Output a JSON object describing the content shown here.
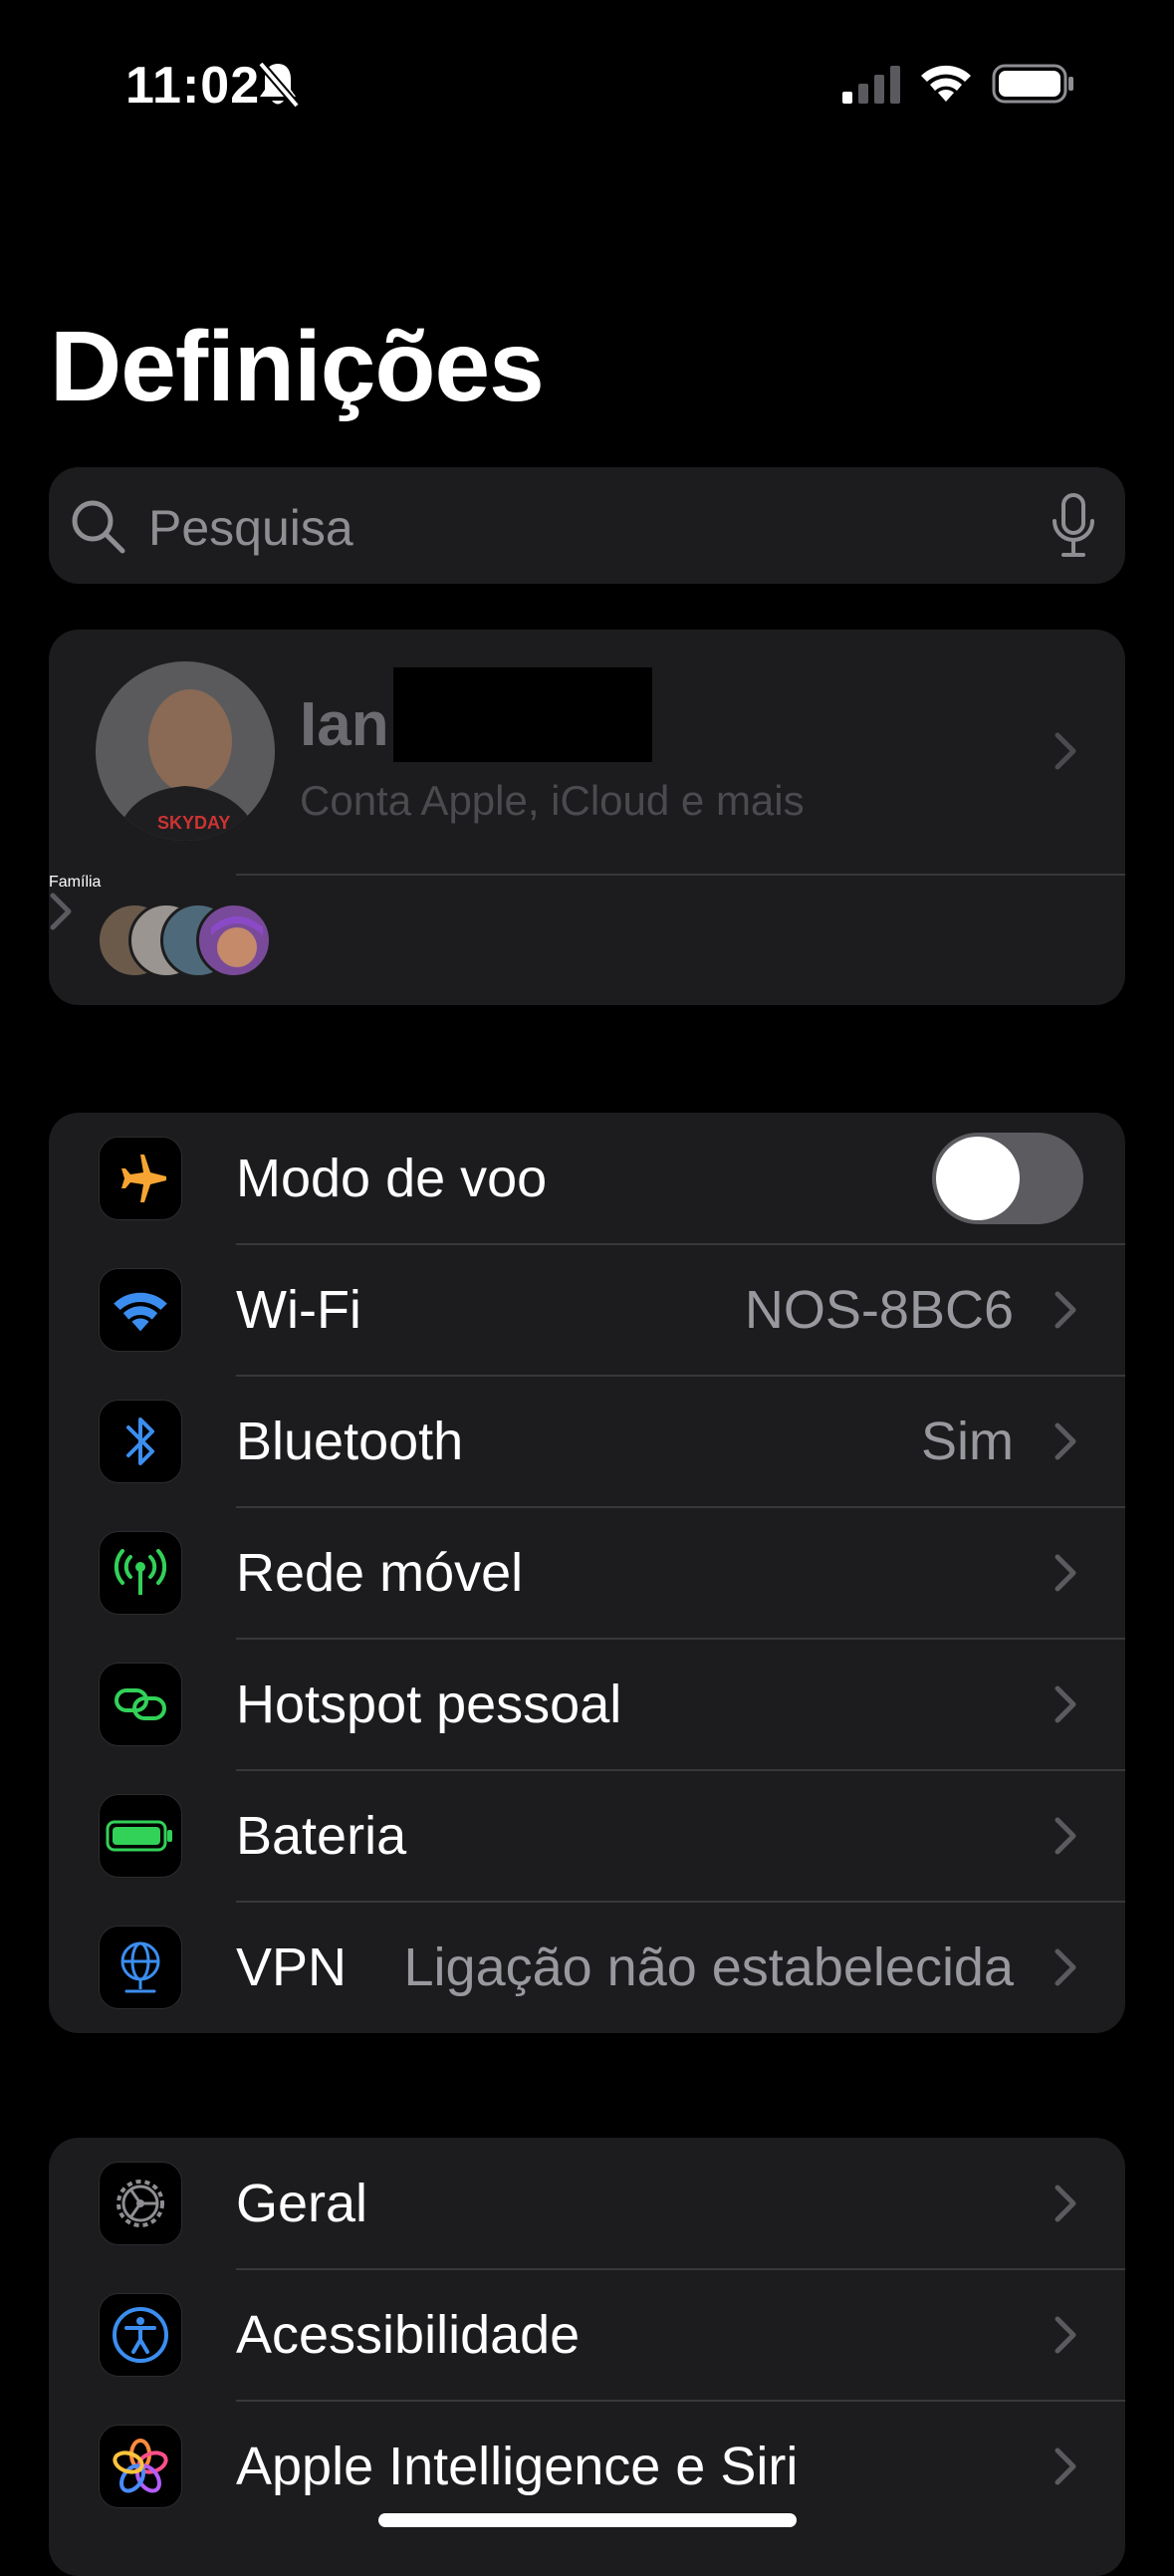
{
  "status_bar": {
    "time": "11:02",
    "silent_mode": true,
    "signal_bars": 1
  },
  "title": "Definições",
  "search": {
    "placeholder": "Pesquisa"
  },
  "profile": {
    "name": "Ian",
    "subtitle": "Conta Apple, iCloud e mais",
    "family_label": "Família"
  },
  "connectivity": [
    {
      "id": "airplane",
      "label": "Modo de voo",
      "value": "",
      "toggle": true,
      "toggle_on": false,
      "icon": "airplane-icon",
      "icon_color": "#f7a532"
    },
    {
      "id": "wifi",
      "label": "Wi-Fi",
      "value": "NOS-8BC6",
      "icon": "wifi-icon",
      "icon_color": "#3b8ef0"
    },
    {
      "id": "bluetooth",
      "label": "Bluetooth",
      "value": "Sim",
      "icon": "bluetooth-icon",
      "icon_color": "#3b8ef0"
    },
    {
      "id": "cellular",
      "label": "Rede móvel",
      "value": "",
      "icon": "antenna-icon",
      "icon_color": "#32d158"
    },
    {
      "id": "hotspot",
      "label": "Hotspot pessoal",
      "value": "",
      "icon": "hotspot-link-icon",
      "icon_color": "#32d158"
    },
    {
      "id": "battery",
      "label": "Bateria",
      "value": "",
      "icon": "battery-icon",
      "icon_color": "#32d158"
    },
    {
      "id": "vpn",
      "label": "VPN",
      "value": "Ligação não estabelecida",
      "icon": "globe-icon",
      "icon_color": "#3b8ef0"
    }
  ],
  "general": [
    {
      "id": "general",
      "label": "Geral",
      "icon": "gear-icon",
      "icon_color": "#8e8e93"
    },
    {
      "id": "accessibility",
      "label": "Acessibilidade",
      "icon": "accessibility-icon",
      "icon_color": "#3b8ef0"
    },
    {
      "id": "siri",
      "label": "Apple Intelligence e Siri",
      "icon": "apple-intelligence-icon",
      "icon_color": "#ff8a3d"
    }
  ]
}
